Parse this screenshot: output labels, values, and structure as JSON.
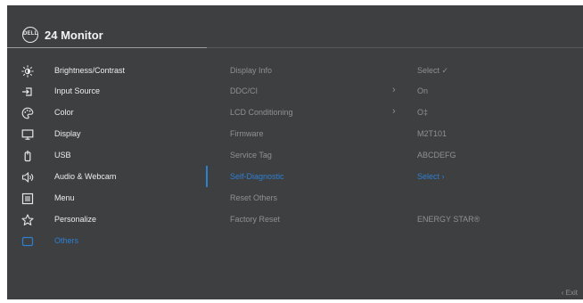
{
  "header": {
    "logo_text": "DELL",
    "title": "24 Monitor"
  },
  "menu": [
    {
      "label": "Brightness/Contrast",
      "icon": "brightness-icon"
    },
    {
      "label": "Input Source",
      "icon": "input-source-icon"
    },
    {
      "label": "Color",
      "icon": "color-palette-icon"
    },
    {
      "label": "Display",
      "icon": "display-icon"
    },
    {
      "label": "USB",
      "icon": "usb-icon"
    },
    {
      "label": "Audio & Webcam",
      "icon": "speaker-icon"
    },
    {
      "label": "Menu",
      "icon": "menu-icon"
    },
    {
      "label": "Personalize",
      "icon": "star-icon"
    },
    {
      "label": "Others",
      "icon": "others-icon",
      "selected": true
    }
  ],
  "options": [
    {
      "label": "Display Info"
    },
    {
      "label": "DDC/CI",
      "arrow": "›"
    },
    {
      "label": "LCD Conditioning",
      "arrow": "›"
    },
    {
      "label": "Firmware"
    },
    {
      "label": "Service Tag"
    },
    {
      "label": "Self-Diagnostic",
      "selected": true
    },
    {
      "label": "Reset Others"
    },
    {
      "label": "Factory Reset"
    }
  ],
  "values": [
    {
      "text": "Select ✓"
    },
    {
      "text": "On"
    },
    {
      "text": "O‡"
    },
    {
      "text": "M2T101"
    },
    {
      "text": "ABCDEFG"
    },
    {
      "text": "Select ›",
      "selected": true
    },
    {
      "text": ""
    },
    {
      "text": "ENERGY STAR®"
    }
  ],
  "footer": {
    "exit_label": "‹ Exit"
  },
  "colors": {
    "background": "#3d3f41",
    "accent": "#2f7fd1",
    "text": "#ededed",
    "muted": "#8e9092"
  }
}
